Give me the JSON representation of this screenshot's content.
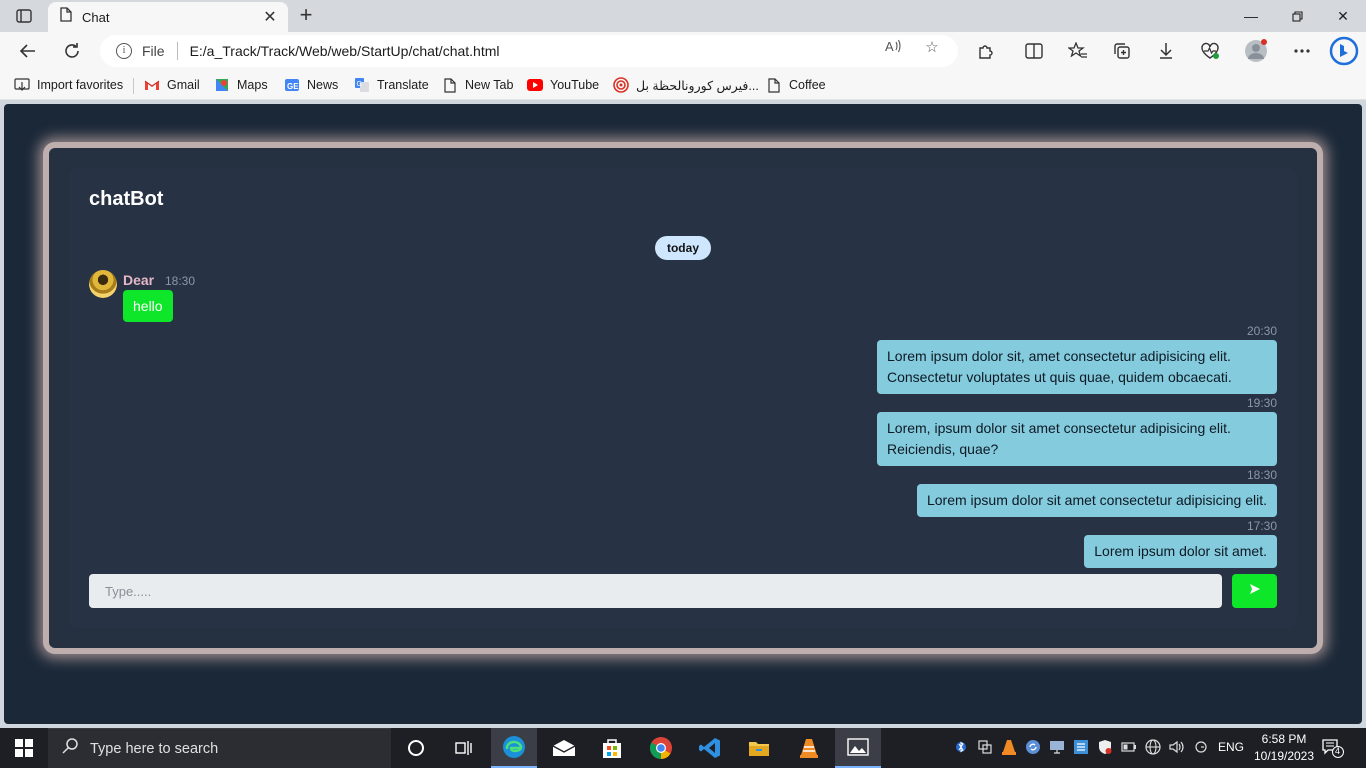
{
  "browser": {
    "tab_title": "Chat",
    "address": {
      "scheme_label": "File",
      "url": "E:/a_Track/Track/Web/web/StartUp/chat/chat.html"
    },
    "favorites": [
      {
        "label": "Import favorites",
        "icon": "import-icon"
      },
      {
        "label": "Gmail",
        "icon": "gmail-icon"
      },
      {
        "label": "Maps",
        "icon": "maps-icon"
      },
      {
        "label": "News",
        "icon": "news-icon"
      },
      {
        "label": "Translate",
        "icon": "translate-icon"
      },
      {
        "label": "New Tab",
        "icon": "page-icon"
      },
      {
        "label": "YouTube",
        "icon": "youtube-icon"
      },
      {
        "label": "فيرس كورونالحظة بل...",
        "icon": "target-icon"
      },
      {
        "label": "Coffee",
        "icon": "page-icon"
      }
    ]
  },
  "chat": {
    "title": "chatBot",
    "day_label": "today",
    "incoming": {
      "sender": "Dear",
      "time": "18:30",
      "text": "hello"
    },
    "outgoing": [
      {
        "time": "20:30",
        "text": "Lorem ipsum dolor sit, amet consectetur adipisicing elit. Consectetur voluptates ut quis quae, quidem obcaecati."
      },
      {
        "time": "19:30",
        "text": "Lorem, ipsum dolor sit amet consectetur adipisicing elit. Reiciendis, quae?"
      },
      {
        "time": "18:30",
        "text": "Lorem ipsum dolor sit amet consectetur adipisicing elit."
      },
      {
        "time": "17:30",
        "text": "Lorem ipsum dolor sit amet."
      }
    ],
    "composer_placeholder": "Type.....",
    "colors": {
      "page_bg": "#1b2838",
      "panel_bg": "#273244",
      "incoming_bubble": "#0ee62a",
      "outgoing_bubble": "#84cbde",
      "send_button": "#0ee62a",
      "glow": "#bfaeae"
    }
  },
  "taskbar": {
    "search_placeholder": "Type here to search",
    "language": "ENG",
    "time": "6:58 PM",
    "date": "10/19/2023",
    "notification_count": "4"
  }
}
